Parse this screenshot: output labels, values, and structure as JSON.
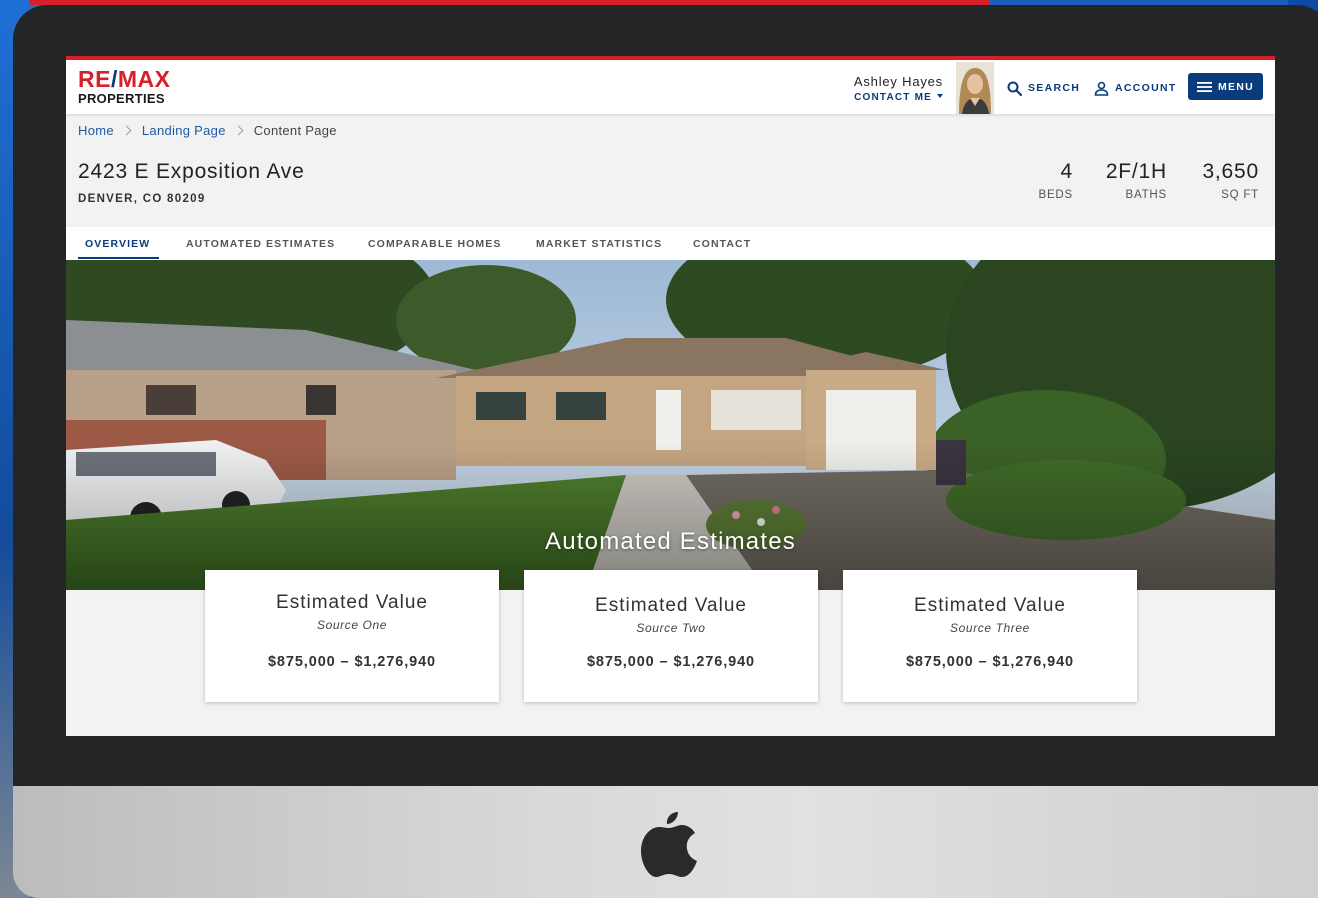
{
  "header": {
    "logo_top_a": "RE",
    "logo_slash": "/",
    "logo_top_b": "MAX",
    "logo_bottom": "PROPERTIES",
    "agent_name": "Ashley Hayes",
    "contact_label": "CONTACT ME",
    "search_label": "SEARCH",
    "account_label": "ACCOUNT",
    "menu_label": "MENU"
  },
  "breadcrumb": {
    "items": [
      "Home",
      "Landing Page"
    ],
    "current": "Content Page"
  },
  "property": {
    "address": "2423 E Exposition Ave",
    "city": "DENVER, CO 80209",
    "stats": [
      {
        "value": "4",
        "label": "BEDS"
      },
      {
        "value": "2F/1H",
        "label": "BATHS"
      },
      {
        "value": "3,650",
        "label": "SQ FT"
      }
    ]
  },
  "tabs": [
    {
      "label": "OVERVIEW",
      "active": true
    },
    {
      "label": "AUTOMATED ESTIMATES"
    },
    {
      "label": "COMPARABLE HOMES"
    },
    {
      "label": "MARKET STATISTICS"
    },
    {
      "label": "CONTACT"
    }
  ],
  "hero": {
    "title": "Automated Estimates"
  },
  "estimates": [
    {
      "title": "Estimated Value",
      "source": "Source One",
      "range": "$875,000 – $1,276,940"
    },
    {
      "title": "Estimated Value",
      "source": "Source Two",
      "range": "$875,000 – $1,276,940"
    },
    {
      "title": "Estimated Value",
      "source": "Source Three",
      "range": "$875,000 – $1,276,940"
    }
  ],
  "colors": {
    "brand_red": "#d8202c",
    "brand_blue": "#0a3b7a",
    "link_blue": "#1f5aa6"
  },
  "icons": {
    "search": "search-icon",
    "account": "user-icon",
    "menu": "hamburger-icon",
    "device": "apple-logo-icon"
  }
}
